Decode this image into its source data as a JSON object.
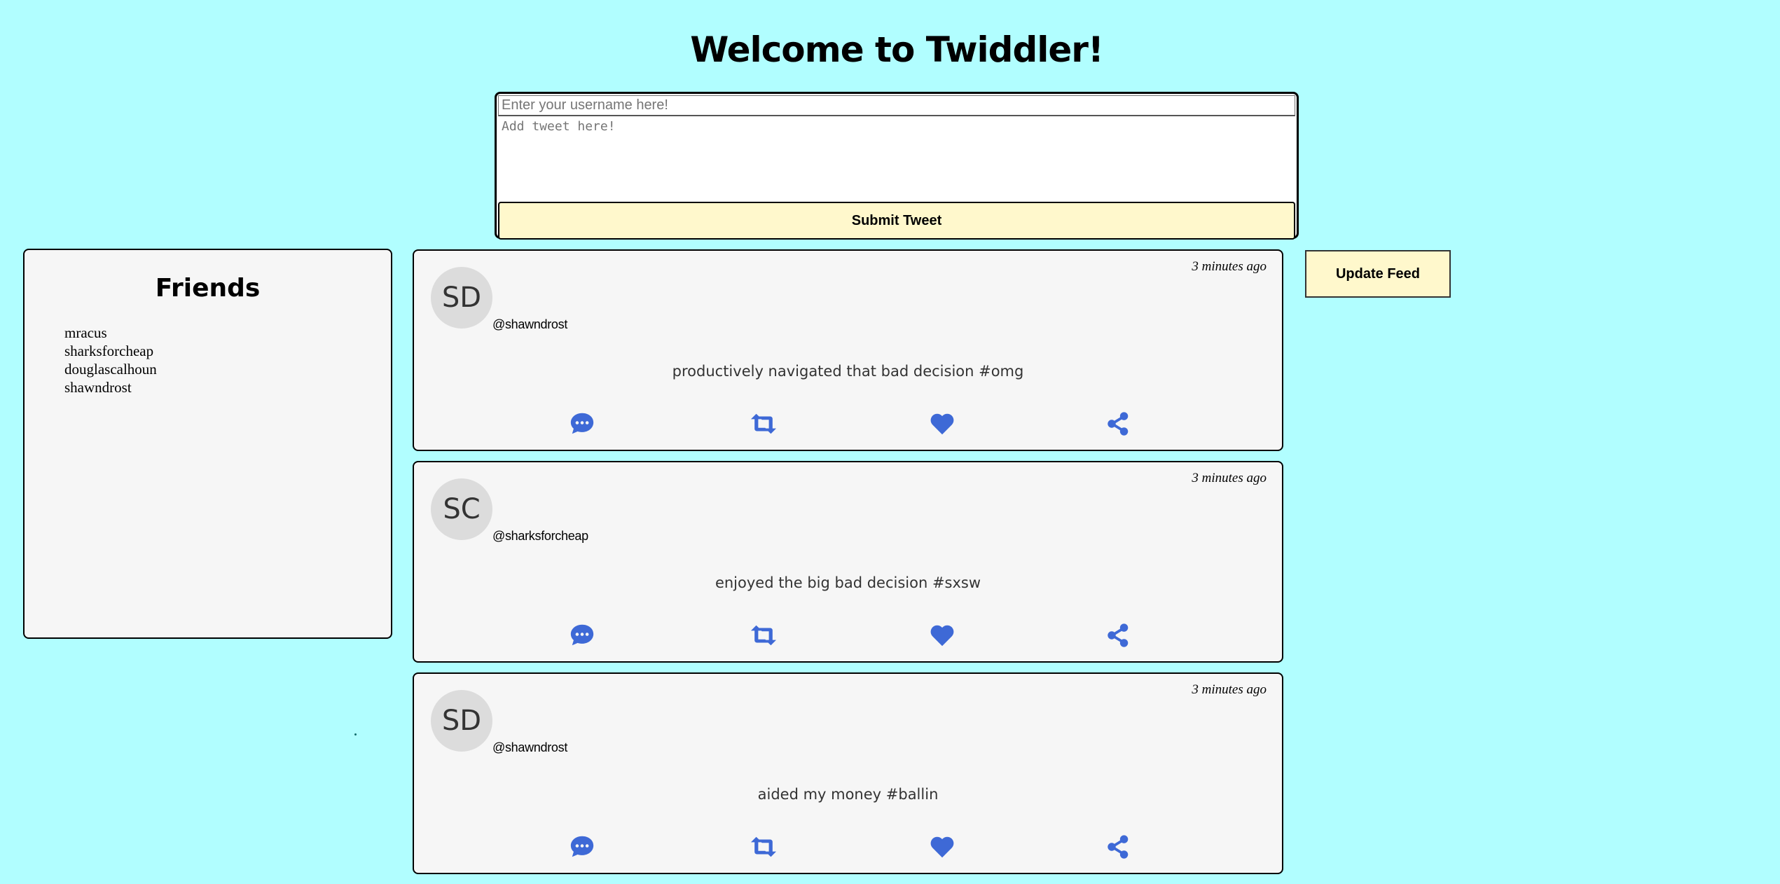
{
  "header": {
    "title": "Welcome to Twiddler!"
  },
  "compose": {
    "username_placeholder": "Enter your username here!",
    "username_value": "",
    "tweet_placeholder": "Add tweet here!",
    "tweet_value": "",
    "submit_label": "Submit Tweet"
  },
  "friends": {
    "title": "Friends",
    "items": [
      "mracus",
      "sharksforcheap",
      "douglascalhoun",
      "shawndrost"
    ]
  },
  "update_feed": {
    "label": "Update Feed"
  },
  "feed": {
    "tweets": [
      {
        "initials": "SD",
        "username": "@shawndrost",
        "timestamp": "3 minutes ago",
        "message": "productively navigated that bad decision #omg"
      },
      {
        "initials": "SC",
        "username": "@sharksforcheap",
        "timestamp": "3 minutes ago",
        "message": "enjoyed the big bad decision #sxsw"
      },
      {
        "initials": "SD",
        "username": "@shawndrost",
        "timestamp": "3 minutes ago",
        "message": "aided my money #ballin"
      }
    ]
  },
  "icons": {
    "comment": "comment-dots-icon",
    "retweet": "retweet-icon",
    "like": "heart-icon",
    "share": "share-icon",
    "color": "#3e69d6"
  },
  "colors": {
    "page_background": "#b1feff",
    "card_background": "#f6f6f6",
    "button_background": "#fff8cc",
    "avatar_background": "#dcdcdc"
  }
}
